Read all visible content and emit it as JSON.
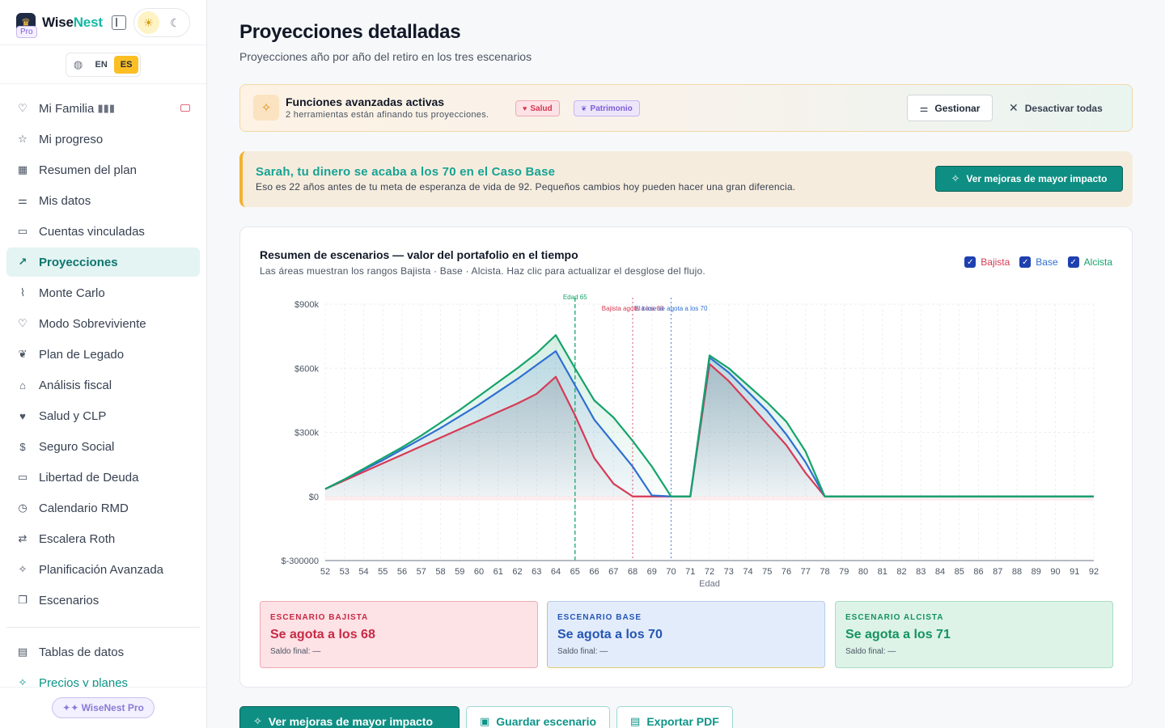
{
  "brand": {
    "name_part1": "Wise",
    "name_part2": "Nest",
    "badge": "Pro"
  },
  "language": {
    "options": [
      "EN",
      "ES"
    ],
    "selected": "ES"
  },
  "sidebar": {
    "items": [
      {
        "label": "Mi Familia",
        "icon": "heart-icon",
        "suffix": "▮▮▮"
      },
      {
        "label": "Mi progreso",
        "icon": "star-icon"
      },
      {
        "label": "Resumen del plan",
        "icon": "grid-icon"
      },
      {
        "label": "Mis datos",
        "icon": "sliders-icon"
      },
      {
        "label": "Cuentas vinculadas",
        "icon": "bank-card-icon"
      },
      {
        "label": "Proyecciones",
        "icon": "trending-up-icon",
        "active": true
      },
      {
        "label": "Monte Carlo",
        "icon": "activity-icon"
      },
      {
        "label": "Modo Sobreviviente",
        "icon": "heart-icon"
      },
      {
        "label": "Plan de Legado",
        "icon": "leaf-icon"
      },
      {
        "label": "Análisis fiscal",
        "icon": "landmark-icon"
      },
      {
        "label": "Salud y CLP",
        "icon": "heart-pulse-icon"
      },
      {
        "label": "Seguro Social",
        "icon": "dollar-circle-icon"
      },
      {
        "label": "Libertad de Deuda",
        "icon": "credit-card-icon"
      },
      {
        "label": "Calendario RMD",
        "icon": "calendar-clock-icon"
      },
      {
        "label": "Escalera Roth",
        "icon": "arrows-exchange-icon"
      },
      {
        "label": "Planificación Avanzada",
        "icon": "sparkles-icon"
      },
      {
        "label": "Escenarios",
        "icon": "layers-icon"
      }
    ],
    "secondary": [
      {
        "label": "Tablas de datos",
        "icon": "table-icon"
      },
      {
        "label": "Precios y planes",
        "icon": "sparkles-icon"
      }
    ],
    "footer_pill": "✦✦ WiseNest Pro"
  },
  "page": {
    "title": "Proyecciones detalladas",
    "subtitle": "Proyecciones año por año del retiro en los tres escenarios"
  },
  "features_banner": {
    "title": "Funciones avanzadas activas",
    "subtitle": "2 herramientas están afinando tus proyecciones.",
    "chips": [
      "Salud",
      "Patrimonio"
    ],
    "manage_label": "Gestionar",
    "deactivate_label": "Desactivar todas"
  },
  "alert": {
    "title": "Sarah, tu dinero se acaba a los 70 en el Caso Base",
    "text": "Eso es 22 años antes de tu meta de esperanza de vida de 92. Pequeños cambios hoy pueden hacer una gran diferencia.",
    "cta": "Ver mejoras de mayor impacto"
  },
  "chart_card": {
    "title": "Resumen de escenarios — valor del portafolio en el tiempo",
    "subtitle": "Las áreas muestran los rangos Bajista · Base · Alcista. Haz clic para actualizar el desglose del flujo.",
    "legend": [
      {
        "name": "Bajista",
        "color": "#d63a55",
        "checked": true
      },
      {
        "name": "Base",
        "color": "#2f6fd1",
        "checked": true
      },
      {
        "name": "Alcista",
        "color": "#16a36b",
        "checked": true
      }
    ]
  },
  "chart_data": {
    "type": "line",
    "xlabel": "Edad",
    "ylabel": "",
    "xlim": [
      52,
      92
    ],
    "ylim": [
      -300000,
      900000
    ],
    "y_ticks": [
      {
        "value": 900000,
        "label": "$900k"
      },
      {
        "value": 600000,
        "label": "$600k"
      },
      {
        "value": 300000,
        "label": "$300k"
      },
      {
        "value": 0,
        "label": "$0"
      },
      {
        "value": -300000,
        "label": "$-300000"
      }
    ],
    "x": [
      52,
      53,
      54,
      55,
      56,
      57,
      58,
      59,
      60,
      61,
      62,
      63,
      64,
      65,
      66,
      67,
      68,
      69,
      70,
      71,
      72,
      73,
      74,
      75,
      76,
      77,
      78,
      79,
      80,
      81,
      82,
      83,
      84,
      85,
      86,
      87,
      88,
      89,
      90,
      91,
      92
    ],
    "series": [
      {
        "name": "Bajista",
        "color": "#d63a55",
        "values": [
          35000,
          75000,
          115000,
          155000,
          195000,
          235000,
          275000,
          315000,
          355000,
          395000,
          435000,
          480000,
          560000,
          380000,
          180000,
          60000,
          0,
          0,
          0,
          0,
          620000,
          540000,
          440000,
          340000,
          240000,
          110000,
          0,
          0,
          0,
          0,
          0,
          0,
          0,
          0,
          0,
          0,
          0,
          0,
          0,
          0,
          0
        ]
      },
      {
        "name": "Base",
        "color": "#2f6fd1",
        "values": [
          35000,
          80000,
          125000,
          170000,
          220000,
          270000,
          320000,
          375000,
          430000,
          490000,
          550000,
          615000,
          680000,
          520000,
          360000,
          250000,
          140000,
          5000,
          0,
          0,
          650000,
          580000,
          490000,
          400000,
          290000,
          160000,
          0,
          0,
          0,
          0,
          0,
          0,
          0,
          0,
          0,
          0,
          0,
          0,
          0,
          0,
          0
        ]
      },
      {
        "name": "Alcista",
        "color": "#16a36b",
        "values": [
          35000,
          80000,
          130000,
          180000,
          230000,
          285000,
          345000,
          405000,
          470000,
          535000,
          600000,
          670000,
          755000,
          600000,
          450000,
          370000,
          260000,
          140000,
          0,
          0,
          660000,
          600000,
          520000,
          440000,
          350000,
          210000,
          0,
          0,
          0,
          0,
          0,
          0,
          0,
          0,
          0,
          0,
          0,
          0,
          0,
          0,
          0
        ]
      }
    ],
    "annotations": [
      {
        "x": 65,
        "label": "Edad 65",
        "color": "#16a36b",
        "style": "dashed"
      },
      {
        "x": 68,
        "label": "Bajista agota a los 68",
        "color": "#d63a55",
        "style": "dotted"
      },
      {
        "x": 70,
        "label": "El base se agota a los 70",
        "color": "#2f6fd1",
        "style": "dotted"
      }
    ],
    "grid": true,
    "legend_position": "top-right"
  },
  "scenarios": [
    {
      "label": "ESCENARIO BAJISTA",
      "value": "Se agota a los 68",
      "final": "Saldo final: —"
    },
    {
      "label": "ESCENARIO BASE",
      "value": "Se agota a los 70",
      "final": "Saldo final: —"
    },
    {
      "label": "ESCENARIO ALCISTA",
      "value": "Se agota a los 71",
      "final": "Saldo final: —"
    }
  ],
  "actions": {
    "primary": "Ver mejoras de mayor impacto",
    "save": "Guardar escenario",
    "export": "Exportar PDF"
  }
}
